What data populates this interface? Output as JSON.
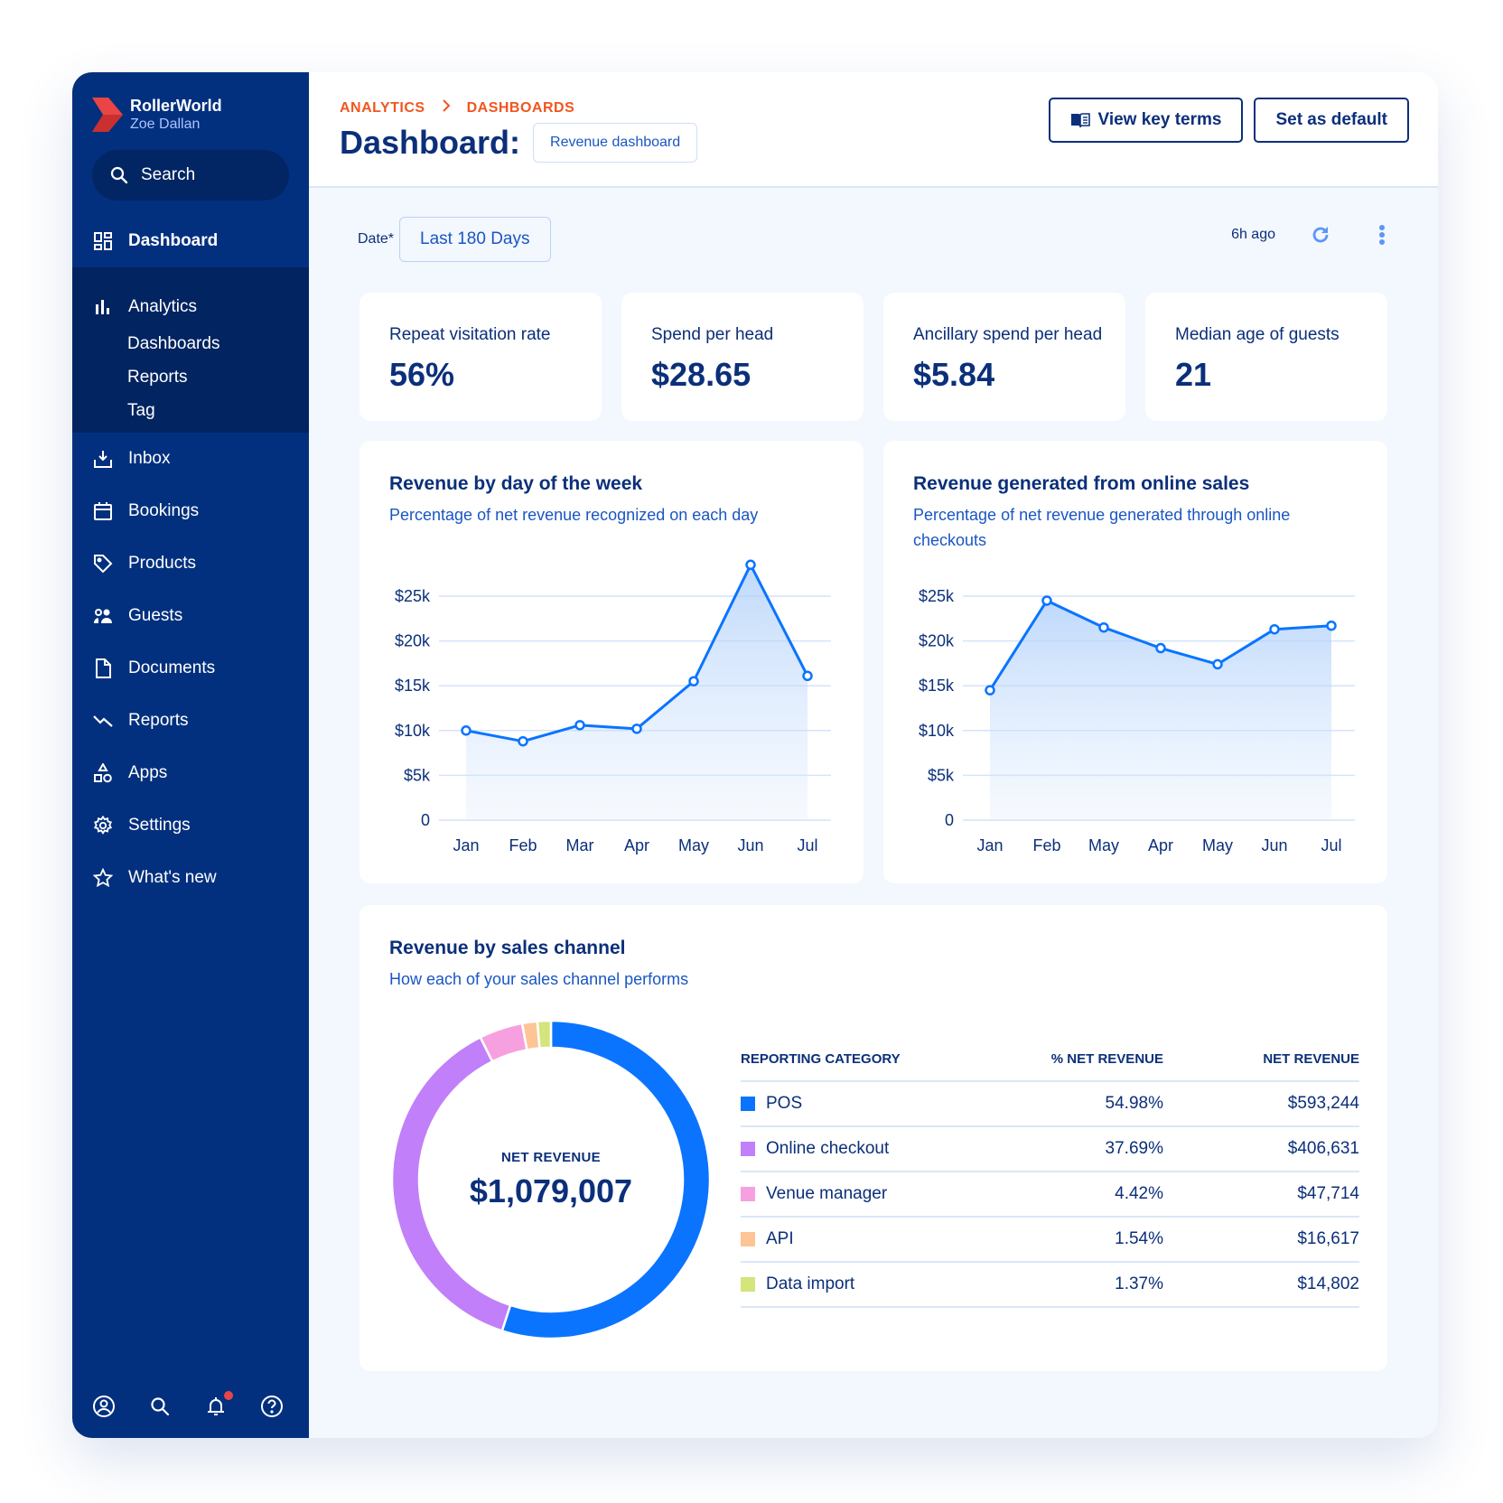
{
  "brand": {
    "name": "RollerWorld",
    "user": "Zoe Dallan",
    "logo_colors": [
      "#e94545",
      "#c22e2e"
    ]
  },
  "sidebar": {
    "search_label": "Search",
    "items": [
      {
        "label": "Dashboard",
        "icon": "dashboard-grid-icon",
        "active": true
      },
      {
        "label": "Analytics",
        "icon": "bar-chart-icon"
      },
      {
        "label": "Inbox",
        "icon": "inbox-download-icon"
      },
      {
        "label": "Bookings",
        "icon": "calendar-icon"
      },
      {
        "label": "Products",
        "icon": "tag-icon"
      },
      {
        "label": "Guests",
        "icon": "users-icon"
      },
      {
        "label": "Documents",
        "icon": "document-icon"
      },
      {
        "label": "Reports",
        "icon": "trend-down-icon"
      },
      {
        "label": "Apps",
        "icon": "shapes-icon"
      },
      {
        "label": "Settings",
        "icon": "gear-icon"
      },
      {
        "label": "What's new",
        "icon": "star-icon"
      }
    ],
    "analytics_sub": [
      "Dashboards",
      "Reports",
      "Tag"
    ],
    "bottom_icons": [
      "profile-icon",
      "search-icon",
      "bell-icon",
      "help-icon"
    ]
  },
  "header": {
    "breadcrumb": [
      "ANALYTICS",
      "DASHBOARDS"
    ],
    "title": "Dashboard:",
    "dashboard_select": "Revenue dashboard",
    "view_key_terms": "View key terms",
    "set_default": "Set as default"
  },
  "filters": {
    "date_label": "Date*",
    "date_value": "Last 180 Days",
    "updated": "6h ago"
  },
  "kpis": [
    {
      "label": "Repeat visitation rate",
      "value": "56%"
    },
    {
      "label": "Spend per head",
      "value": "$28.65"
    },
    {
      "label": "Ancillary spend per head",
      "value": "$5.84"
    },
    {
      "label": "Median age of guests",
      "value": "21"
    }
  ],
  "colors": {
    "accent": "#0a74ff",
    "navy": "#0b2f7a",
    "sidebar": "#03307e",
    "orange": "#f0561f"
  },
  "chart_data": [
    {
      "type": "area",
      "title": "Revenue by day of the week",
      "subtitle": "Percentage of net revenue recognized on each day",
      "categories": [
        "Jan",
        "Feb",
        "Mar",
        "Apr",
        "May",
        "Jun",
        "Jul"
      ],
      "values": [
        10000,
        8800,
        10600,
        10200,
        15500,
        28500,
        16100
      ],
      "yticks": [
        "0",
        "$5k",
        "$10k",
        "$15k",
        "$20k",
        "$25k"
      ],
      "ylim": [
        0,
        25000
      ],
      "grid": true
    },
    {
      "type": "area",
      "title": "Revenue generated from online sales",
      "subtitle": "Percentage of net revenue generated through online checkouts",
      "categories": [
        "Jan",
        "Feb",
        "May",
        "Apr",
        "May",
        "Jun",
        "Jul"
      ],
      "values": [
        14500,
        24500,
        21500,
        19200,
        17400,
        21300,
        21700
      ],
      "yticks": [
        "0",
        "$5k",
        "$10k",
        "$15k",
        "$20k",
        "$25k"
      ],
      "ylim": [
        0,
        25000
      ],
      "grid": true
    },
    {
      "type": "pie",
      "title": "Revenue by sales channel",
      "subtitle": "How each of your sales channel performs",
      "center_label": "NET REVENUE",
      "center_value": "$1,079,007",
      "columns": [
        "REPORTING CATEGORY",
        "% NET REVENUE",
        "NET REVENUE"
      ],
      "slices": [
        {
          "name": "POS",
          "percent": 54.98,
          "pct_label": "54.98%",
          "revenue": "$593,244",
          "color": "#0a74ff"
        },
        {
          "name": "Online checkout",
          "percent": 37.69,
          "pct_label": "37.69%",
          "revenue": "$406,631",
          "color": "#c17ff9"
        },
        {
          "name": "Venue manager",
          "percent": 4.42,
          "pct_label": "4.42%",
          "revenue": "$47,714",
          "color": "#f7a0e0"
        },
        {
          "name": "API",
          "percent": 1.54,
          "pct_label": "1.54%",
          "revenue": "$16,617",
          "color": "#fdc596"
        },
        {
          "name": "Data import",
          "percent": 1.37,
          "pct_label": "1.37%",
          "revenue": "$14,802",
          "color": "#d3e57c"
        }
      ]
    }
  ]
}
